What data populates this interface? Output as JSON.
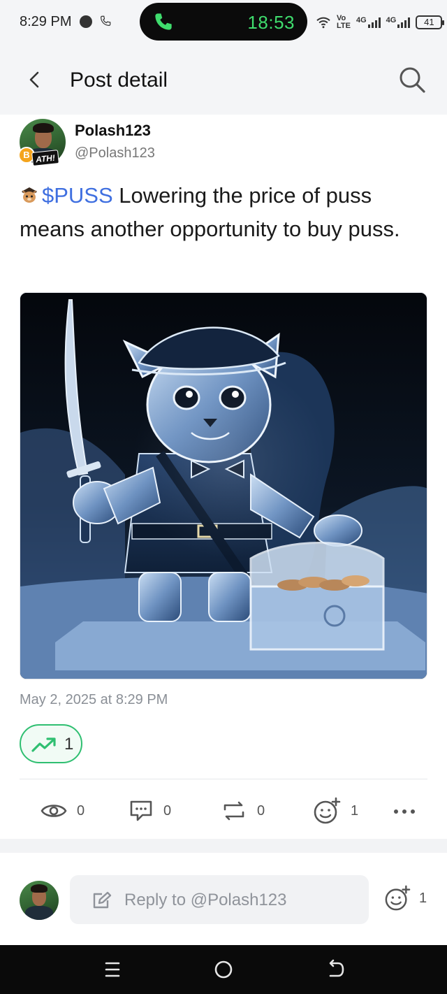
{
  "status_bar": {
    "time": "8:29 PM",
    "call_time": "18:53",
    "net_label_top": "Vo",
    "net_label_bottom": "LTE",
    "sim1": "4G",
    "sim2": "4G",
    "battery": "41",
    "call_color": "#3fdc6d"
  },
  "header": {
    "back_icon": "chevron-left-icon",
    "title": "Post detail",
    "search_icon": "search-icon"
  },
  "author": {
    "name": "Polash123",
    "handle": "@Polash123",
    "badge_coin": "B",
    "badge_label": "ATH!"
  },
  "post": {
    "ticker_icon": "cat-pirate-icon",
    "ticker": "$PUSS",
    "text": " Lowering the price of puss means another opportunity to buy puss.",
    "image_description_icon": "pirate-ice-cat-image",
    "date": "May 2, 2025 at 8:29 PM",
    "trend_count": "1",
    "accent_green": "#2fbf71",
    "accent_blue": "#3f6fe0"
  },
  "actions": {
    "views": "0",
    "comments": "0",
    "reposts": "0",
    "reactions": "1"
  },
  "reply": {
    "placeholder": "Reply to @Polash123",
    "reaction_count": "1"
  }
}
